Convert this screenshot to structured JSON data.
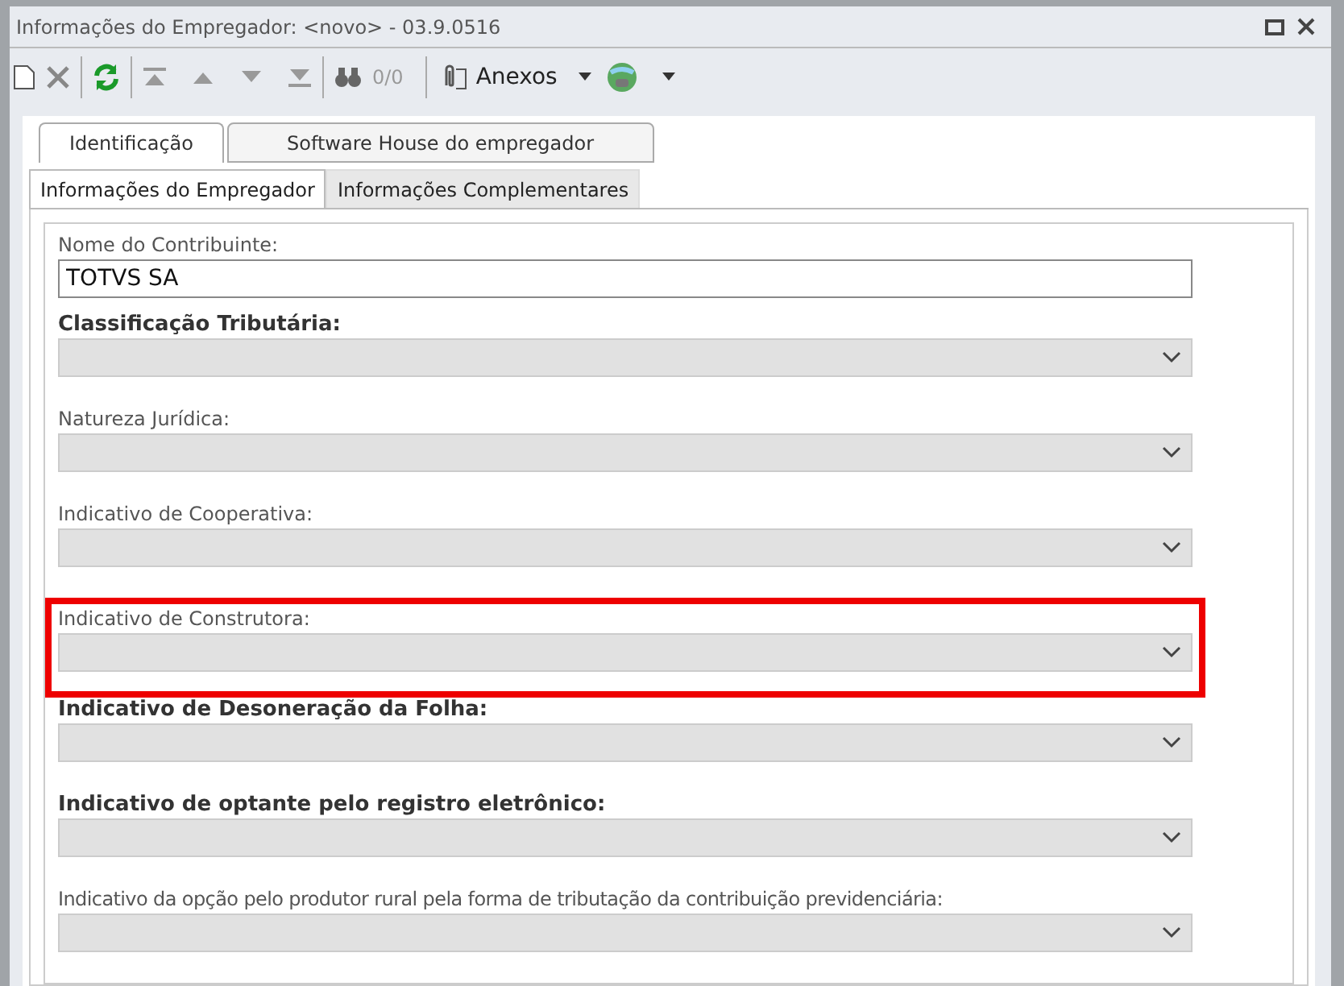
{
  "window": {
    "title": "Informações do Empregador: <novo> - 03.9.0516"
  },
  "toolbar": {
    "counter": "0/0",
    "attachments_label": "Anexos"
  },
  "tabs": [
    {
      "label": "Identificação",
      "selected": true
    },
    {
      "label": "Software House do empregador",
      "selected": false
    }
  ],
  "subtabs": [
    {
      "label": "Informações do Empregador",
      "selected": true
    },
    {
      "label": "Informações Complementares",
      "selected": false
    }
  ],
  "fields": [
    {
      "kind": "text",
      "label": "Nome do Contribuinte:",
      "bold": false,
      "value": "TOTVS SA",
      "highlighted": false
    },
    {
      "kind": "select",
      "label": "Classificação Tributária:",
      "bold": true,
      "highlighted": false
    },
    {
      "kind": "select",
      "label": "Natureza Jurídica:",
      "bold": false,
      "highlighted": false
    },
    {
      "kind": "select",
      "label": "Indicativo de Cooperativa:",
      "bold": false,
      "highlighted": false
    },
    {
      "kind": "select",
      "label": "Indicativo de Construtora:",
      "bold": false,
      "highlighted": true
    },
    {
      "kind": "select",
      "label": "Indicativo de Desoneração da Folha:",
      "bold": true,
      "highlighted": false
    },
    {
      "kind": "select",
      "label": "Indicativo de optante pelo registro eletrônico:",
      "bold": true,
      "highlighted": false
    },
    {
      "kind": "select",
      "label": "Indicativo da opção pelo produtor rural pela forma de tributação da contribuição previdenciária:",
      "bold": false,
      "highlighted": false
    }
  ]
}
